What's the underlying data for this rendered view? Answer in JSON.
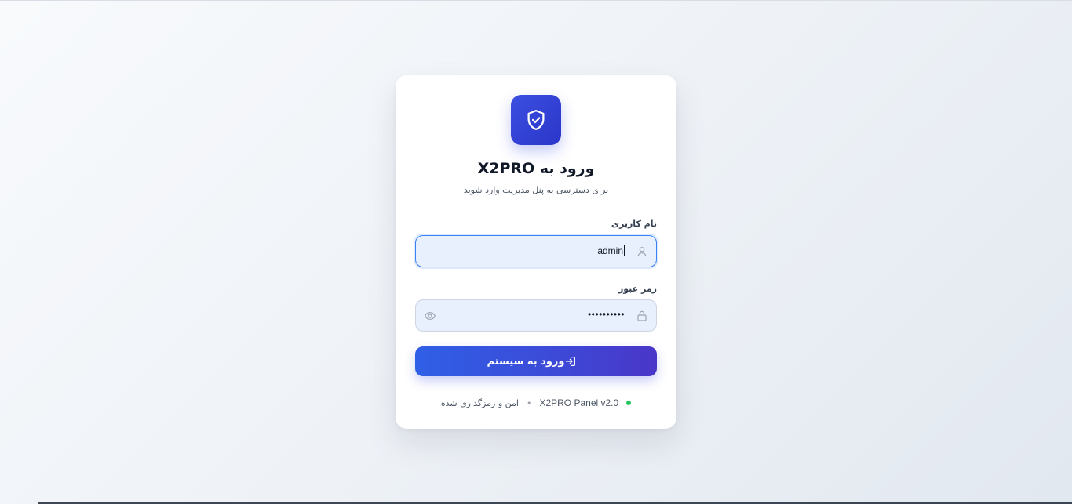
{
  "header": {
    "title": "ورود به X2PRO",
    "subtitle": "برای دسترسی به پنل مدیریت وارد شوید"
  },
  "username": {
    "label": "نام کاربری",
    "value": "admin",
    "icon": "user-icon"
  },
  "password": {
    "label": "رمز عبور",
    "value": "••••••••••",
    "icon": "lock-icon",
    "toggle_icon": "eye-icon"
  },
  "submit": {
    "label": "ورود به سیستم",
    "icon": "login-icon"
  },
  "footer": {
    "secure_text": "امن و رمزگذاری شده",
    "separator": "•",
    "version_text": "X2PRO Panel v2.0",
    "status_color": "#22c55e"
  },
  "colors": {
    "accent": "#3b4fe0",
    "button_gradient_start": "#2f5fe6",
    "button_gradient_end": "#4a36c8",
    "field_bg": "#e8f0fe"
  }
}
